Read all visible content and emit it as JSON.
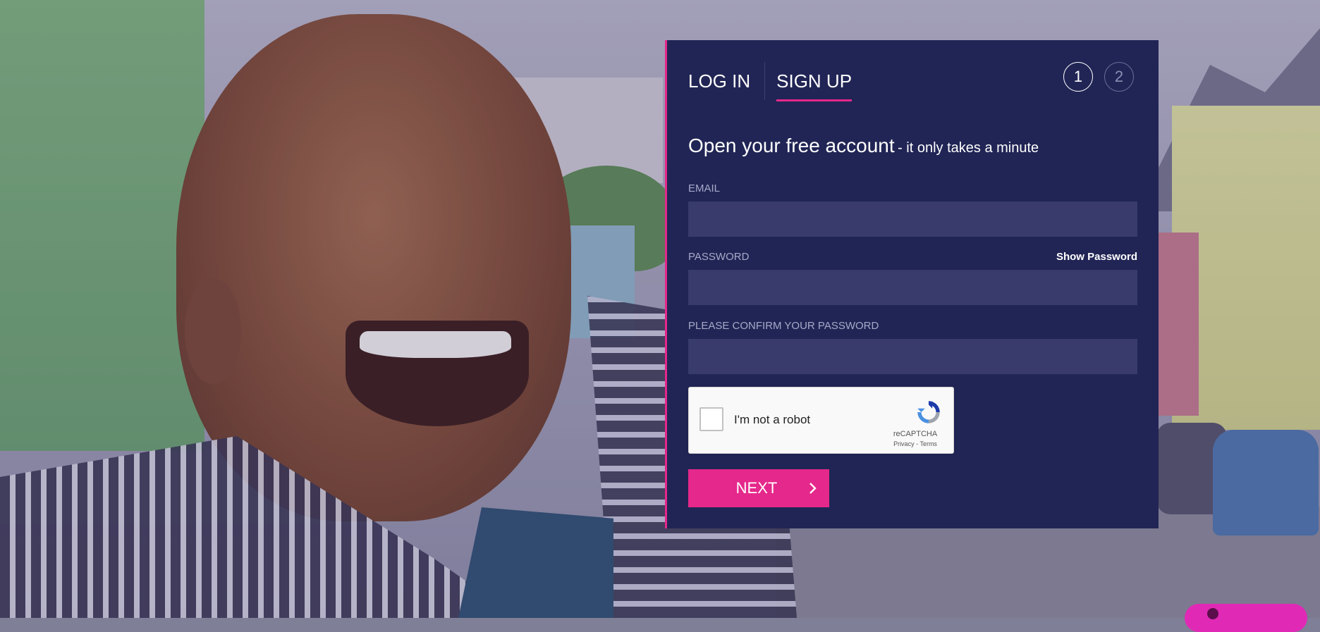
{
  "tabs": {
    "login_label": "LOG IN",
    "signup_label": "SIGN UP"
  },
  "steps": [
    "1",
    "2"
  ],
  "headline": {
    "main": "Open your free account",
    "sub": "- it only takes a minute"
  },
  "form": {
    "email_label": "EMAIL",
    "email_value": "",
    "password_label": "PASSWORD",
    "password_value": "",
    "show_password_label": "Show Password",
    "confirm_label": "PLEASE CONFIRM YOUR PASSWORD",
    "confirm_value": ""
  },
  "recaptcha": {
    "checkbox_label": "I'm not a robot",
    "brand": "reCAPTCHA",
    "privacy_link": "Privacy",
    "separator": "-",
    "terms_link": "Terms"
  },
  "next_button": {
    "label": "NEXT"
  },
  "colors": {
    "panel": "#212555",
    "accent": "#e5288b",
    "input": "#383b6b",
    "chat": "#e02ab6"
  },
  "icons": {
    "next": "chevron-right-icon",
    "recaptcha": "recaptcha-logo-icon",
    "chat": "chat-icon"
  }
}
